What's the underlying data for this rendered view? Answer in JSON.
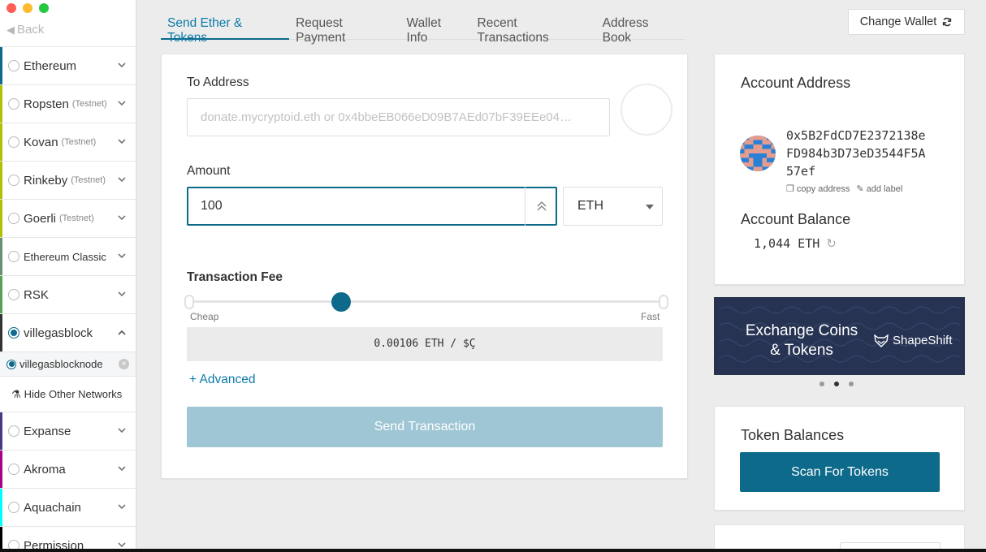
{
  "window": {
    "traffic_lights": [
      "#fd5f57",
      "#fdbb2e",
      "#27c840"
    ]
  },
  "nav": {
    "back_label": "Back",
    "back_icon": "back-arrow-icon"
  },
  "networks": [
    {
      "name": "Ethereum",
      "sub": "",
      "color": "#0e6a8a",
      "selected": false,
      "expanded": false
    },
    {
      "name": "Ropsten",
      "sub": "(Testnet)",
      "color": "#adc101",
      "selected": false,
      "expanded": false
    },
    {
      "name": "Kovan",
      "sub": "(Testnet)",
      "color": "#adc101",
      "selected": false,
      "expanded": false
    },
    {
      "name": "Rinkeby",
      "sub": "(Testnet)",
      "color": "#adc101",
      "selected": false,
      "expanded": false
    },
    {
      "name": "Goerli",
      "sub": "(Testnet)",
      "color": "#adc101",
      "selected": false,
      "expanded": false
    },
    {
      "name": "Ethereum Classic",
      "sub": "",
      "color": "#669073",
      "selected": false,
      "expanded": false
    },
    {
      "name": "RSK",
      "sub": "",
      "color": "#58a052",
      "selected": false,
      "expanded": false
    },
    {
      "name": "villegasblock",
      "sub": "",
      "color": "#333333",
      "selected": true,
      "expanded": true
    }
  ],
  "custom_node": {
    "label": "villegasblocknode",
    "selected": true
  },
  "hide_other_label": "Hide Other Networks",
  "networks_after": [
    {
      "name": "Expanse",
      "color": "#4b3a83"
    },
    {
      "name": "Akroma",
      "color": "#aa0087"
    },
    {
      "name": "Aquachain",
      "color": "#00ffff"
    },
    {
      "name": "Permission",
      "color": "#000000"
    }
  ],
  "tabs": [
    "Send Ether & Tokens",
    "Request Payment",
    "Wallet Info",
    "Recent Transactions",
    "Address Book"
  ],
  "active_tab": 0,
  "change_wallet_label": "Change Wallet",
  "send": {
    "to_label": "To Address",
    "to_placeholder": "donate.mycryptoid.eth or 0x4bbeEB066eD09B7AEd07bF39EEe04…",
    "amount_label": "Amount",
    "amount_value": "100",
    "unit_value": "ETH",
    "fee_label": "Transaction Fee",
    "fee_cheap": "Cheap",
    "fee_fast": "Fast",
    "fee_slider_level": 0.32,
    "fee_value": "0.00106 ETH / $Ç",
    "advanced_label": "+ Advanced",
    "send_button_label": "Send Transaction"
  },
  "account": {
    "address_title": "Account Address",
    "address": "0x5B2FdCD7E2372138eFD984b3D73eD3544F5A57ef",
    "copy_label": "copy address",
    "add_label": "add label",
    "balance_title": "Account Balance",
    "balance": "1,044 ETH"
  },
  "banner": {
    "text": "Exchange Coins & Tokens",
    "brand": "ShapeShift",
    "dots": 3,
    "active_dot": 1
  },
  "tokens": {
    "title": "Token Balances",
    "scan_label": "Scan For Tokens"
  }
}
